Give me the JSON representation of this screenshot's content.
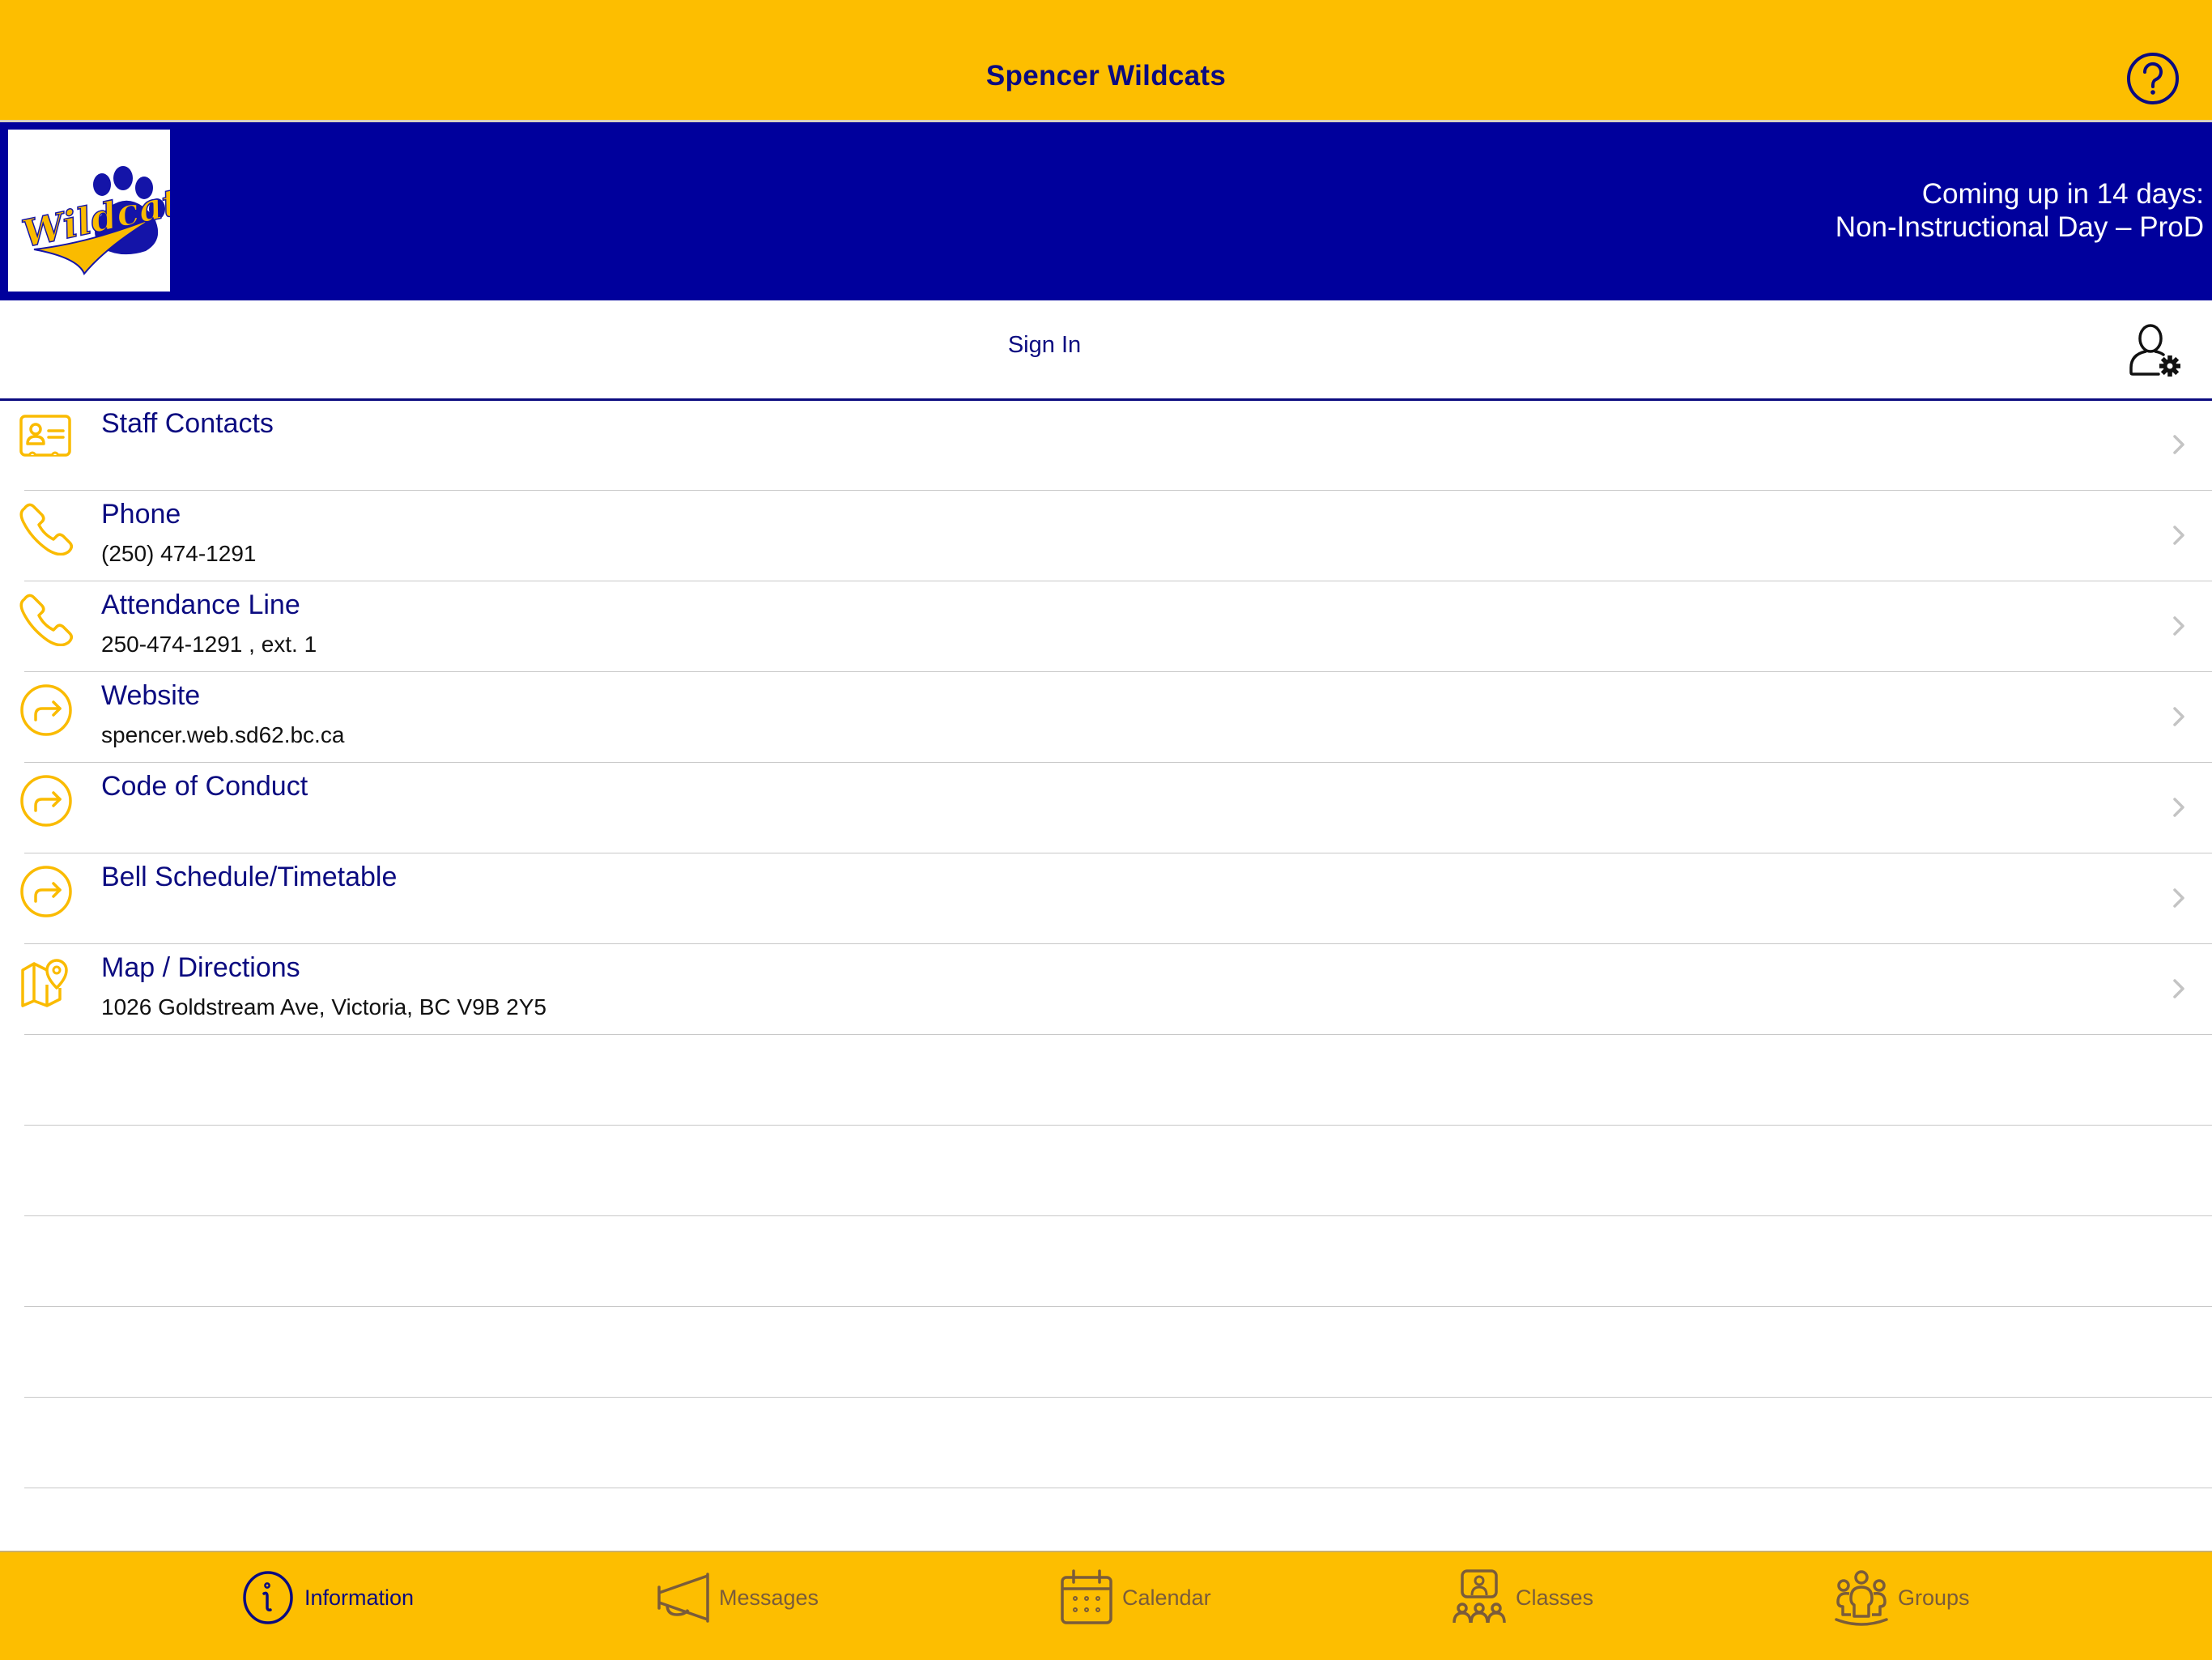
{
  "header": {
    "title": "Spencer Wildcats",
    "help_icon": "question-circle-icon"
  },
  "banner": {
    "logo_alt": "Wildcats",
    "event_line1": "Coming up in 14 days:",
    "event_line2": "Non-Instructional Day – ProD"
  },
  "account": {
    "sign_in_label": "Sign In",
    "settings_icon": "user-gear-icon"
  },
  "list": {
    "items": [
      {
        "title": "Staff Contacts",
        "subtitle": "",
        "icon": "contact-card-icon"
      },
      {
        "title": "Phone",
        "subtitle": "(250) 474-1291",
        "icon": "phone-icon"
      },
      {
        "title": "Attendance Line",
        "subtitle": "250-474-1291 , ext. 1",
        "icon": "phone-icon"
      },
      {
        "title": "Website",
        "subtitle": "spencer.web.sd62.bc.ca",
        "icon": "link-arrow-icon"
      },
      {
        "title": "Code of Conduct",
        "subtitle": "",
        "icon": "link-arrow-icon"
      },
      {
        "title": "Bell Schedule/Timetable",
        "subtitle": "",
        "icon": "link-arrow-icon"
      },
      {
        "title": "Map / Directions",
        "subtitle": "1026 Goldstream Ave, Victoria, BC V9B 2Y5",
        "icon": "map-pin-icon"
      }
    ]
  },
  "tabs": [
    {
      "label": "Information",
      "icon": "info-icon",
      "active": true
    },
    {
      "label": "Messages",
      "icon": "megaphone-icon",
      "active": false
    },
    {
      "label": "Calendar",
      "icon": "calendar-icon",
      "active": false
    },
    {
      "label": "Classes",
      "icon": "classes-icon",
      "active": false
    },
    {
      "label": "Groups",
      "icon": "groups-icon",
      "active": false
    }
  ],
  "colors": {
    "brand_yellow": "#FDBE00",
    "brand_blue": "#00009C",
    "text_navy": "#0B0B80",
    "icon_yellow": "#FABB00",
    "tab_inactive": "#7A5C3A"
  }
}
